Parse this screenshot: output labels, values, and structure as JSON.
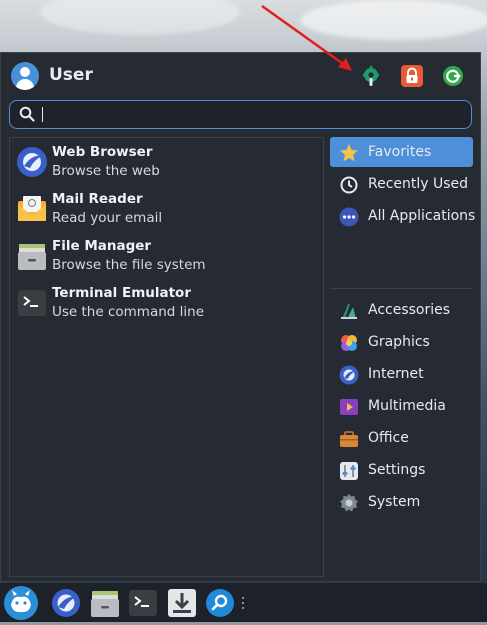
{
  "header": {
    "username": "User",
    "buttons": [
      {
        "icon": "settings-icon",
        "color": "#1e9d6a"
      },
      {
        "icon": "lock-icon",
        "color": "#e85a3a"
      },
      {
        "icon": "logout-icon",
        "color": "#2eaa4a"
      }
    ]
  },
  "search": {
    "value": "",
    "placeholder": ""
  },
  "apps": [
    {
      "name": "Web Browser",
      "description": "Browse the web",
      "icon": "web-browser-icon"
    },
    {
      "name": "Mail Reader",
      "description": "Read your email",
      "icon": "mail-reader-icon"
    },
    {
      "name": "File Manager",
      "description": "Browse the file system",
      "icon": "file-manager-icon"
    },
    {
      "name": "Terminal Emulator",
      "description": "Use the command line",
      "icon": "terminal-icon"
    }
  ],
  "categories": [
    {
      "label": "Favorites",
      "icon": "star-icon",
      "active": true
    },
    {
      "label": "Recently Used",
      "icon": "clock-icon",
      "active": false
    },
    {
      "label": "All Applications",
      "icon": "dots-icon",
      "active": false
    },
    {
      "label": "Accessories",
      "icon": "accessories-icon",
      "active": false
    },
    {
      "label": "Graphics",
      "icon": "graphics-icon",
      "active": false
    },
    {
      "label": "Internet",
      "icon": "internet-icon",
      "active": false
    },
    {
      "label": "Multimedia",
      "icon": "multimedia-icon",
      "active": false
    },
    {
      "label": "Office",
      "icon": "office-icon",
      "active": false
    },
    {
      "label": "Settings",
      "icon": "settings-category-icon",
      "active": false
    },
    {
      "label": "System",
      "icon": "system-icon",
      "active": false
    }
  ],
  "taskbar": {
    "items": [
      "whisker-menu-icon",
      "web-browser-icon",
      "file-manager-icon",
      "terminal-icon",
      "downloads-icon",
      "search-icon"
    ]
  },
  "colors": {
    "accent": "#4d8fd8",
    "menu_bg": "#252a33",
    "annotation_arrow": "#e02020"
  }
}
